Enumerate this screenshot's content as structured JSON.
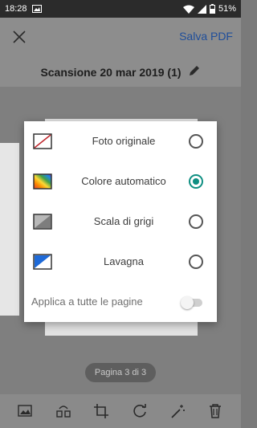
{
  "status_bar": {
    "time": "18:28",
    "battery": "51%"
  },
  "app_bar": {
    "save_label": "Salva PDF"
  },
  "document": {
    "title": "Scansione 20 mar 2019 (1)"
  },
  "dialog": {
    "options": [
      {
        "label": "Foto originale",
        "selected": false
      },
      {
        "label": "Colore automatico",
        "selected": true
      },
      {
        "label": "Scala di grigi",
        "selected": false
      },
      {
        "label": "Lavagna",
        "selected": false
      }
    ],
    "apply_all": {
      "label": "Applica a tutte le pagine",
      "enabled": false
    }
  },
  "pager": {
    "label": "Pagina 3 di 3"
  },
  "colors": {
    "accent": "#0f8f82",
    "link": "#1f4e9a"
  }
}
